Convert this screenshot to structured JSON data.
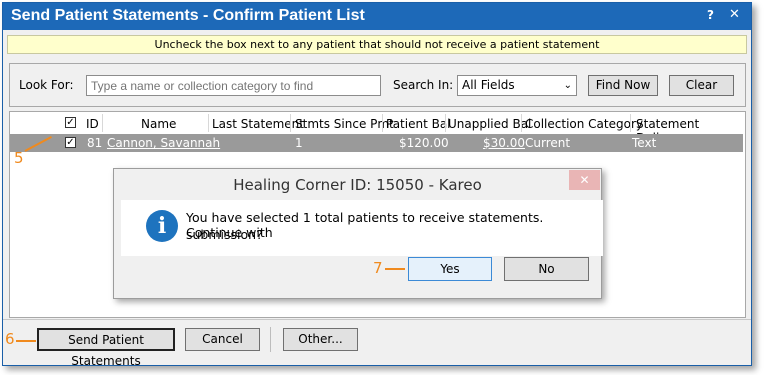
{
  "window": {
    "title": "Send Patient Statements - Confirm Patient List",
    "help_label": "?",
    "close_label": "✕"
  },
  "banner": "Uncheck the box next to any patient that should not receive a patient statement",
  "search": {
    "look_for_label": "Look For:",
    "placeholder": "Type a name or collection category to find",
    "search_in_label": "Search In:",
    "search_in_value": "All Fields",
    "find_now_label": "Find Now",
    "clear_label": "Clear"
  },
  "table": {
    "columns": [
      "ID",
      "Name",
      "Last Statement",
      "Stmts Since Pmt",
      "Patient Bal",
      "Unapplied Bal",
      "Collection Category",
      "Statement Delivery"
    ],
    "rows": [
      {
        "checked": "✓",
        "id": "81",
        "name": "Cannon, Savannah",
        "last_statement": "",
        "stmts_since_pmt": "1",
        "patient_bal": "$120.00",
        "unapplied_bal": "$30.00",
        "collection_category": "Current",
        "statement_delivery": "Text"
      }
    ]
  },
  "dialog": {
    "title": "Healing Corner ID: 15050 - Kareo",
    "close_label": "✕",
    "icon_glyph": "i",
    "message_line1": "You have selected 1 total patients to receive statements. Continue with",
    "message_line2": "submission?",
    "yes_label": "Yes",
    "no_label": "No"
  },
  "footer": {
    "send_label": "Send Patient Statements",
    "cancel_label": "Cancel",
    "other_label": "Other..."
  },
  "callouts": {
    "step5": "5",
    "step6": "6",
    "step7": "7"
  },
  "colors": {
    "titlebar": "#1d69b8",
    "callout": "#f08a1e",
    "selected_row": "#9a9a9a",
    "banner": "#ffffcc"
  }
}
